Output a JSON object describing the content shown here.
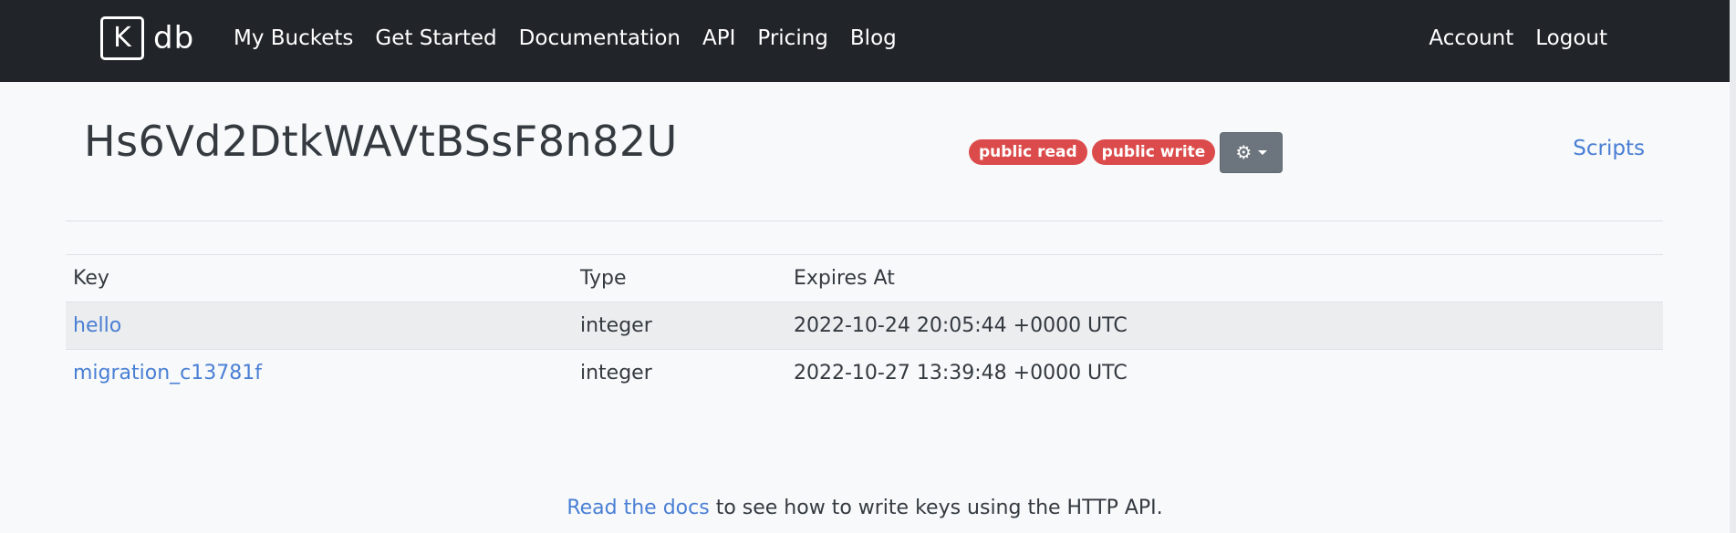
{
  "navbar": {
    "logo": {
      "box_letters": "K",
      "text": "db"
    },
    "left_links": [
      "My Buckets",
      "Get Started",
      "Documentation",
      "API",
      "Pricing",
      "Blog"
    ],
    "account_label": "Account",
    "logout_label": "Logout"
  },
  "bucket": {
    "name": "Hs6Vd2DtkWAVtBSsF8n82U",
    "badges": {
      "public_read": "public read",
      "public_write": "public write"
    },
    "settings_icon": "gear-icon",
    "scripts_label": "Scripts"
  },
  "table": {
    "headers": {
      "key": "Key",
      "type": "Type",
      "expires": "Expires At"
    },
    "rows": [
      {
        "key": "hello",
        "type": "integer",
        "expires_at": "2022-10-24 20:05:44 +0000 UTC"
      },
      {
        "key": "migration_c13781f",
        "type": "integer",
        "expires_at": "2022-10-27 13:39:48 +0000 UTC"
      }
    ]
  },
  "footer": {
    "docs_link": "Read the docs",
    "text_after": " to see how to write keys using the HTTP API."
  },
  "colors": {
    "navbar_bg": "#212529",
    "badge_red": "#dc4b4b",
    "link_blue": "#4a7fd4",
    "settings_button": "#6c757d"
  }
}
